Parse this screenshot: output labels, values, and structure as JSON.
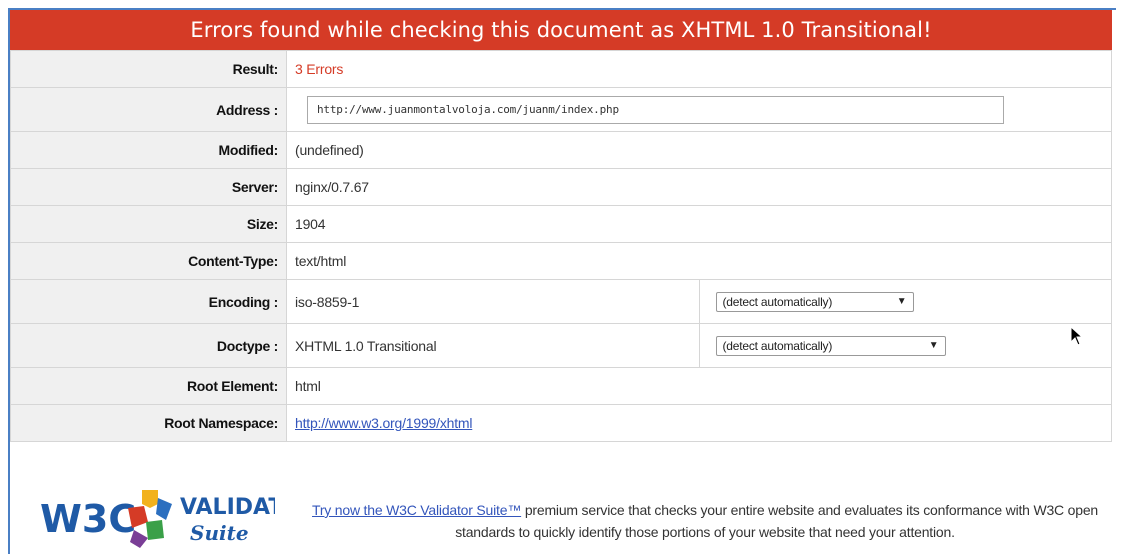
{
  "banner": {
    "title": "Errors found while checking this document as XHTML 1.0 Transitional!"
  },
  "rows": {
    "result": {
      "label": "Result:",
      "value": "3 Errors"
    },
    "address": {
      "label": "Address :",
      "value": "http://www.juanmontalvoloja.com/juanm/index.php"
    },
    "modified": {
      "label": "Modified:",
      "value": "(undefined)"
    },
    "server": {
      "label": "Server:",
      "value": "nginx/0.7.67"
    },
    "size": {
      "label": "Size:",
      "value": "1904"
    },
    "content_type": {
      "label": "Content-Type:",
      "value": "text/html"
    },
    "encoding": {
      "label": "Encoding :",
      "value": "iso-8859-1",
      "select": "(detect automatically)"
    },
    "doctype": {
      "label": "Doctype :",
      "value": "XHTML 1.0 Transitional",
      "select": "(detect automatically)"
    },
    "root_element": {
      "label": "Root Element:",
      "value": "html"
    },
    "root_namespace": {
      "label": "Root Namespace:",
      "value": "http://www.w3.org/1999/xhtml"
    }
  },
  "footer": {
    "logo_w3c": "W3C",
    "logo_validator": "VALIDATOR",
    "logo_suite": "Suite",
    "link_text": "Try now the W3C Validator Suite™",
    "text": " premium service that checks your entire website and evaluates its conformance with W3C open standards to quickly identify those portions of your website that need your attention."
  },
  "colors": {
    "banner": "#d53b26",
    "error": "#d53b26",
    "link": "#3355bb",
    "label_bg": "#f0f0f0"
  }
}
